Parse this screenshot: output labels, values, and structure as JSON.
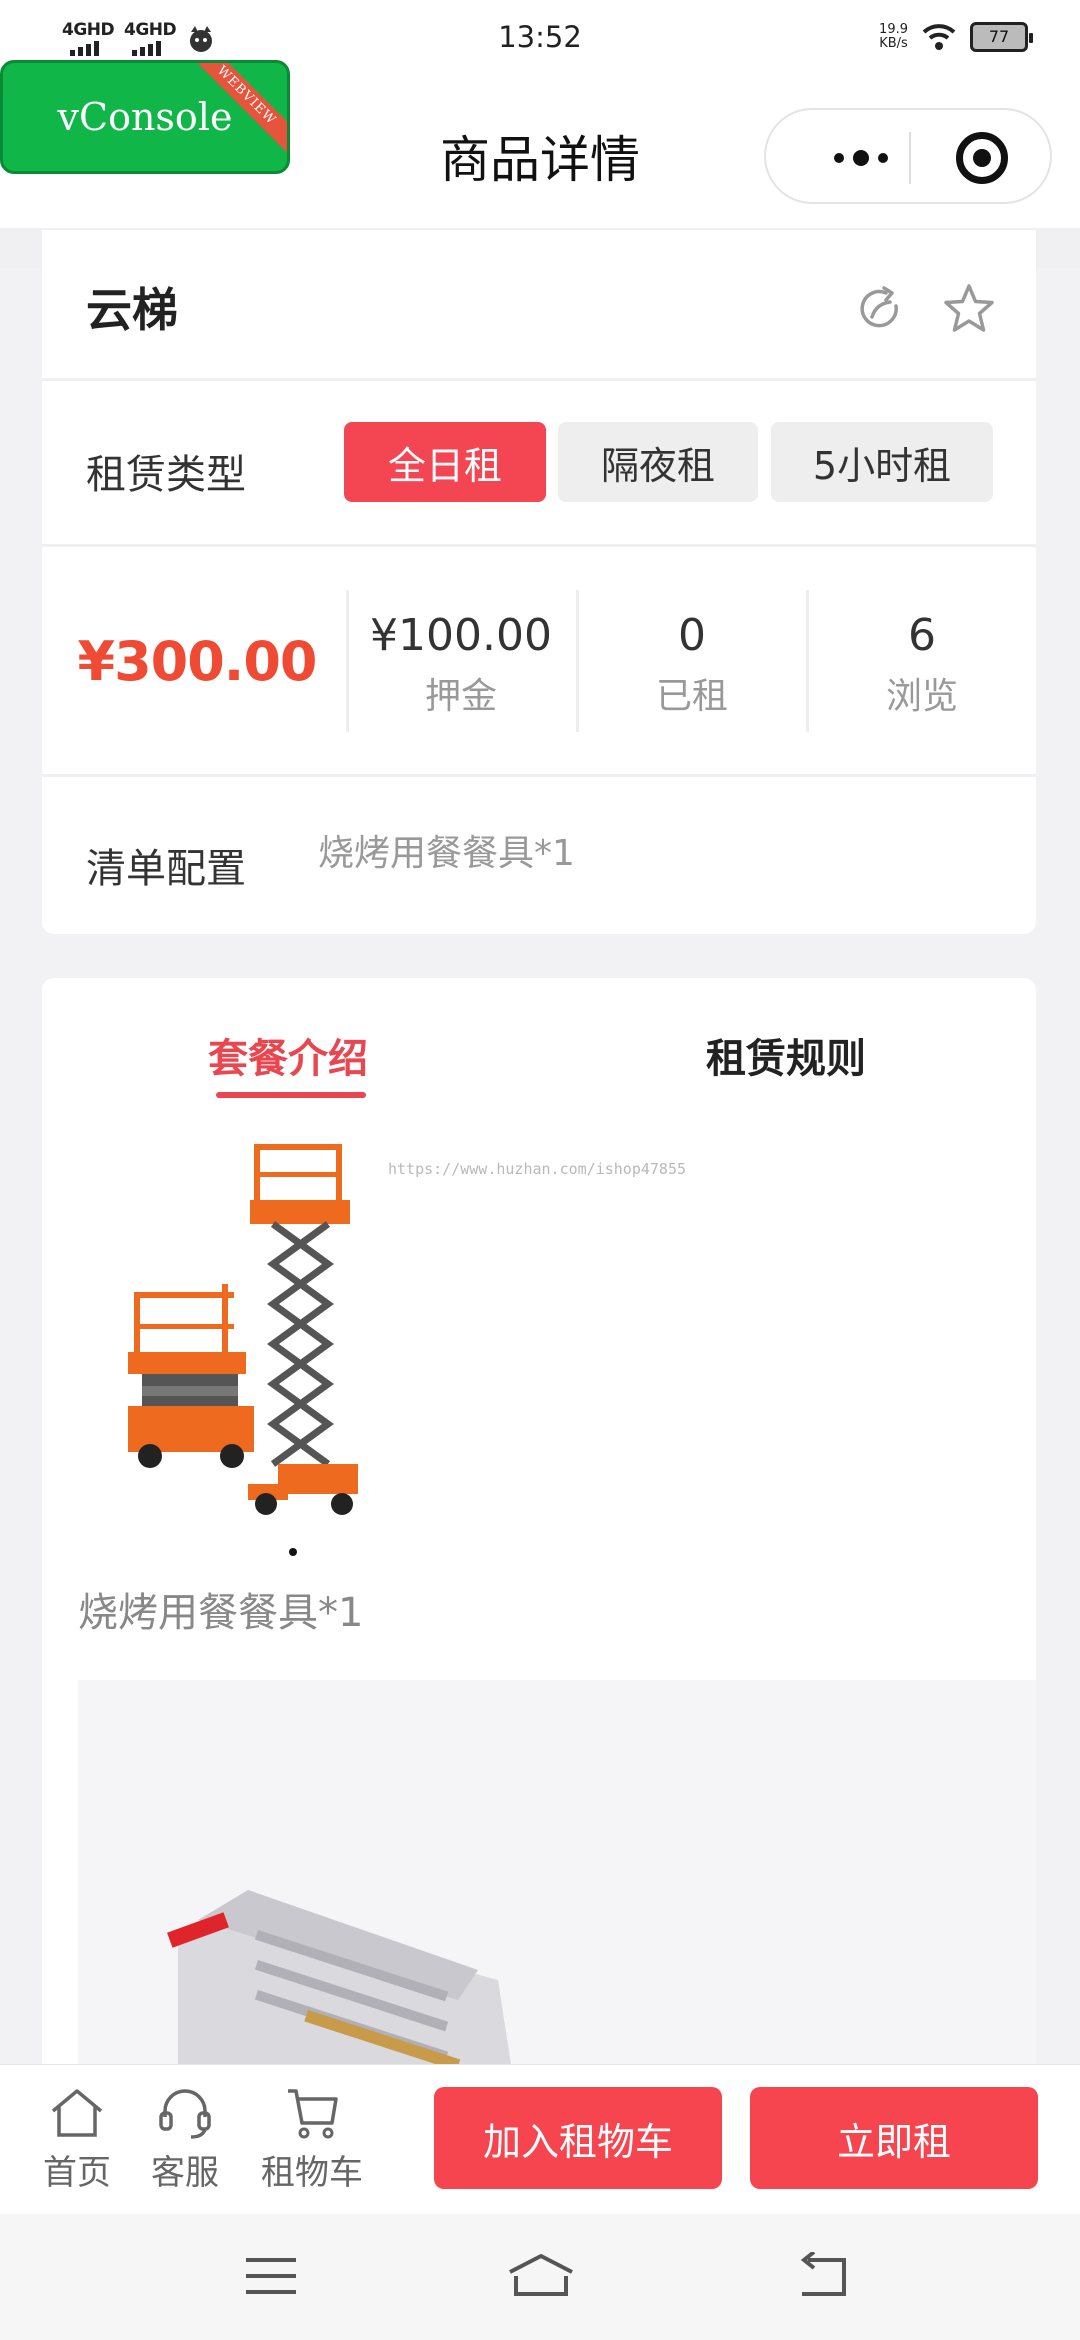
{
  "status_bar": {
    "time": "13:52",
    "signal1": "4GHD",
    "signal2": "4GHD",
    "net_speed_value": "19.9",
    "net_speed_unit": "KB/s",
    "battery": "77"
  },
  "nav": {
    "title": "商品详情"
  },
  "vconsole": {
    "label": "vConsole",
    "ribbon": "WEBVIEW"
  },
  "product": {
    "name": "云梯",
    "rent_type_label": "租赁类型",
    "rent_types": [
      {
        "label": "全日租",
        "active": true
      },
      {
        "label": "隔夜租",
        "active": false
      },
      {
        "label": "5小时租",
        "active": false
      }
    ],
    "price": "¥300.00",
    "stats": [
      {
        "value": "¥100.00",
        "label": "押金"
      },
      {
        "value": "0",
        "label": "已租"
      },
      {
        "value": "6",
        "label": "浏览"
      }
    ],
    "list_config_label": "清单配置",
    "list_config_value": "烧烤用餐餐具*1"
  },
  "detail": {
    "tabs": [
      {
        "label": "套餐介绍",
        "active": true
      },
      {
        "label": "租赁规则",
        "active": false
      }
    ],
    "watermark": "https://www.huzhan.com/ishop47855",
    "description": "烧烤用餐餐具*1"
  },
  "action_bar": {
    "home": "首页",
    "service": "客服",
    "cart": "租物车",
    "add_to_cart": "加入租物车",
    "rent_now": "立即租"
  },
  "colors": {
    "accent": "#f6454f",
    "price": "#ef4a33",
    "vconsole": "#10b648"
  }
}
